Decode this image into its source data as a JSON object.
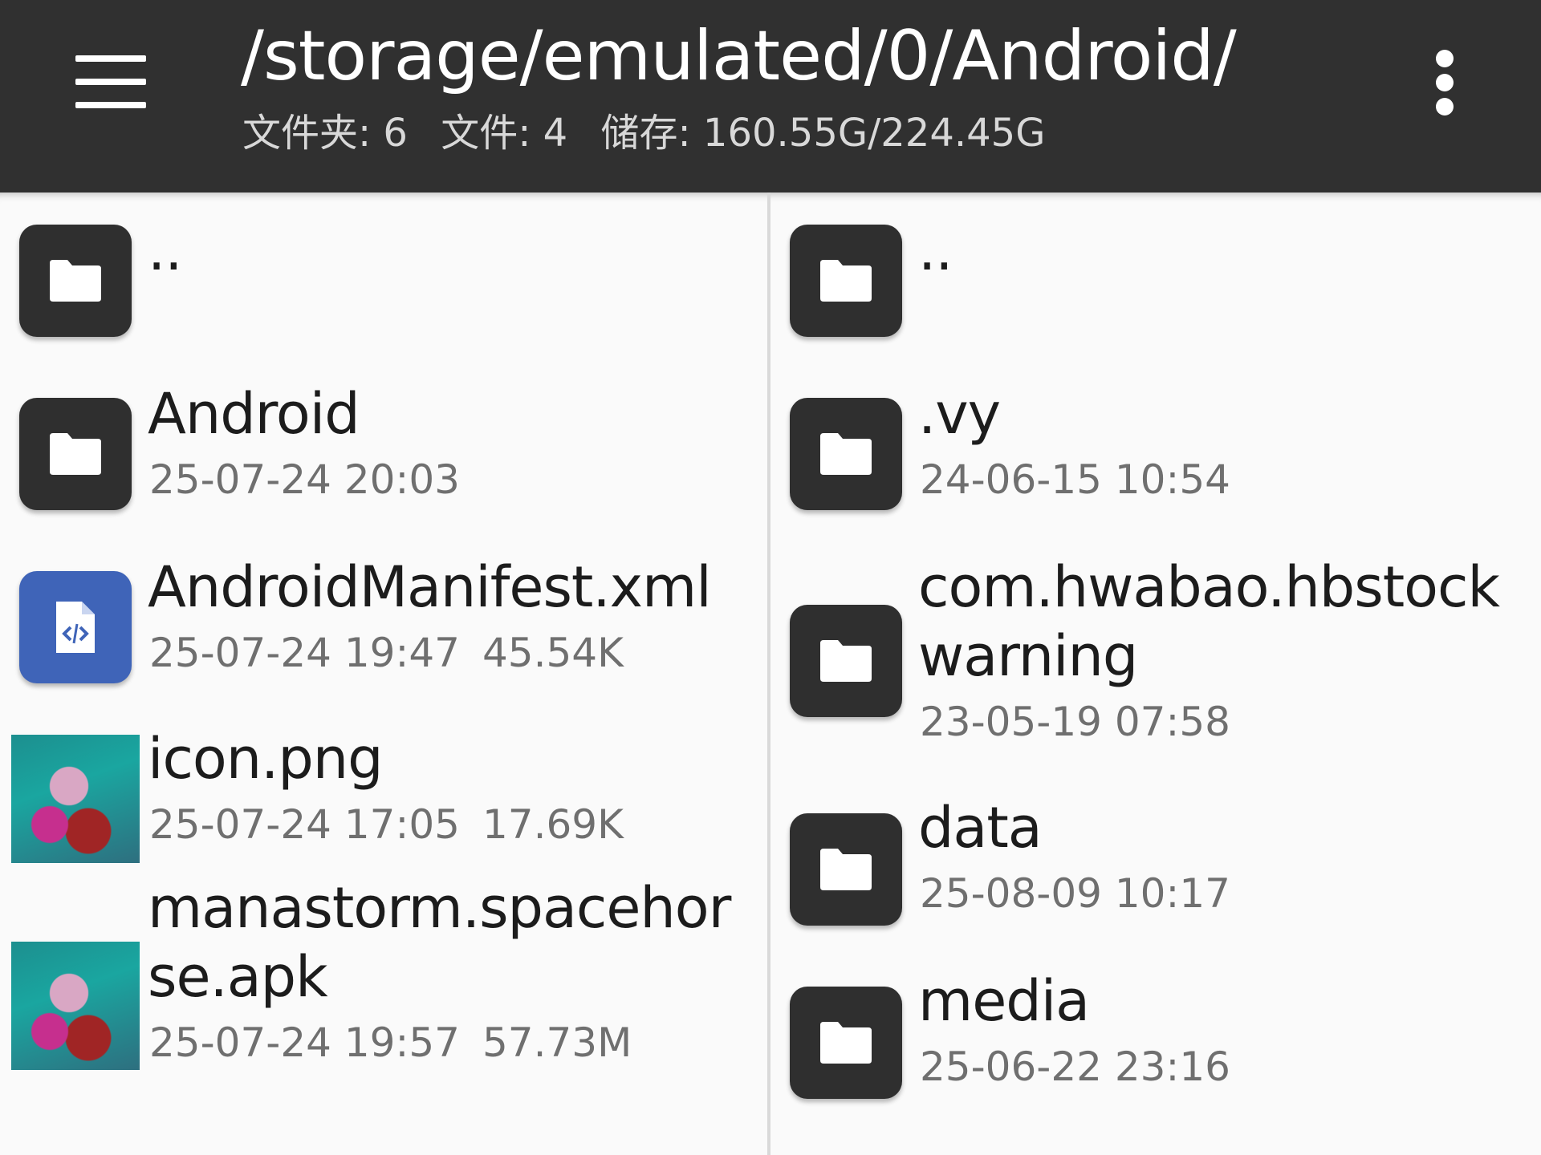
{
  "header": {
    "title": "/storage/emulated/0/Android/",
    "stats": {
      "folders": "文件夹: 6",
      "files": "文件: 4",
      "storage": "储存: 160.55G/224.45G"
    }
  },
  "left_pane": {
    "items": [
      {
        "name": [
          "..",
          ""
        ],
        "date": "",
        "size": "",
        "icon": "folder-icon"
      },
      {
        "name": [
          "Android",
          ""
        ],
        "date": "25-07-24 20:03",
        "size": "",
        "icon": "folder-icon"
      },
      {
        "name": [
          "AndroidManifest.xml",
          ""
        ],
        "date": "25-07-24 19:47",
        "size": "45.54K",
        "icon": "xml-file-icon"
      },
      {
        "name": [
          "icon.png",
          ""
        ],
        "date": "25-07-24 17:05",
        "size": "17.69K",
        "icon": "image-thumbnail"
      },
      {
        "name": [
          "manastorm.spacehor",
          "se.apk"
        ],
        "date": "25-07-24 19:57",
        "size": "57.73M",
        "icon": "apk-thumbnail"
      }
    ]
  },
  "right_pane": {
    "items": [
      {
        "name": [
          "..",
          ""
        ],
        "date": "",
        "icon": "folder-icon"
      },
      {
        "name": [
          ".vy",
          ""
        ],
        "date": "24-06-15 10:54",
        "icon": "folder-icon"
      },
      {
        "name": [
          "com.hwabao.hbstock",
          "warning"
        ],
        "date": "23-05-19 07:58",
        "icon": "folder-icon"
      },
      {
        "name": [
          "data",
          ""
        ],
        "date": "25-08-09 10:17",
        "icon": "folder-icon"
      },
      {
        "name": [
          "media",
          ""
        ],
        "date": "25-06-22 23:16",
        "icon": "folder-icon"
      }
    ]
  },
  "colors": {
    "appbar": "#303030",
    "folder_icon_bg": "#2f2f2f",
    "xml_icon_bg": "#3f64b8",
    "pane_bg": "#fafafa"
  }
}
